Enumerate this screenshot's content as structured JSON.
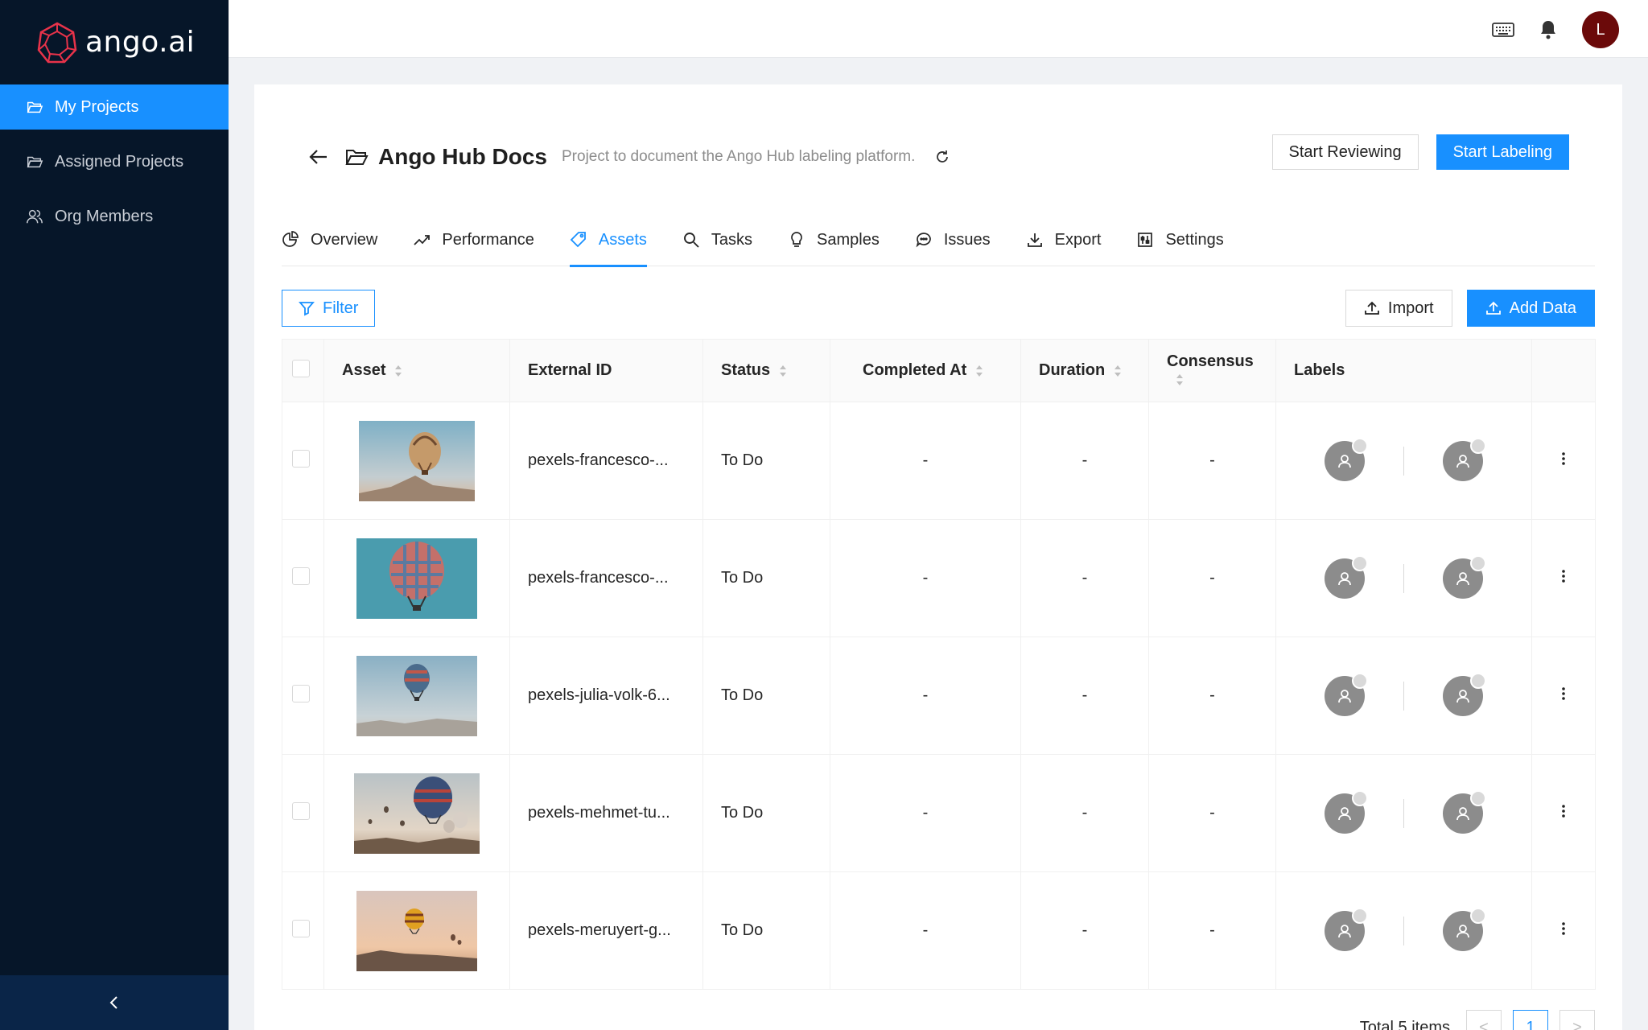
{
  "app": {
    "logo_text": "ango.ai"
  },
  "sidebar": {
    "items": [
      {
        "label": "My Projects",
        "icon": "folder-open-icon",
        "active": true
      },
      {
        "label": "Assigned Projects",
        "icon": "folder-open-icon",
        "active": false
      },
      {
        "label": "Org Members",
        "icon": "users-icon",
        "active": false
      }
    ]
  },
  "header": {
    "avatar_letter": "L"
  },
  "project": {
    "title": "Ango Hub Docs",
    "description": "Project to document the Ango Hub labeling platform.",
    "start_reviewing": "Start Reviewing",
    "start_labeling": "Start Labeling"
  },
  "tabs": [
    {
      "label": "Overview",
      "icon": "pie-chart-icon"
    },
    {
      "label": "Performance",
      "icon": "line-chart-icon"
    },
    {
      "label": "Assets",
      "icon": "tag-icon",
      "active": true
    },
    {
      "label": "Tasks",
      "icon": "search-icon"
    },
    {
      "label": "Samples",
      "icon": "bulb-icon"
    },
    {
      "label": "Issues",
      "icon": "comment-icon"
    },
    {
      "label": "Export",
      "icon": "download-icon"
    },
    {
      "label": "Settings",
      "icon": "settings-icon"
    }
  ],
  "toolbar": {
    "filter_label": "Filter",
    "import_label": "Import",
    "add_data_label": "Add Data"
  },
  "table": {
    "columns": [
      "Asset",
      "External ID",
      "Status",
      "Completed At",
      "Duration",
      "Consensus",
      "Labels"
    ],
    "rows": [
      {
        "external_id": "pexels-francesco-...",
        "status": "To Do",
        "completed_at": "-",
        "duration": "-",
        "consensus": "-"
      },
      {
        "external_id": "pexels-francesco-...",
        "status": "To Do",
        "completed_at": "-",
        "duration": "-",
        "consensus": "-"
      },
      {
        "external_id": "pexels-julia-volk-6...",
        "status": "To Do",
        "completed_at": "-",
        "duration": "-",
        "consensus": "-"
      },
      {
        "external_id": "pexels-mehmet-tu...",
        "status": "To Do",
        "completed_at": "-",
        "duration": "-",
        "consensus": "-"
      },
      {
        "external_id": "pexels-meruyert-g...",
        "status": "To Do",
        "completed_at": "-",
        "duration": "-",
        "consensus": "-"
      }
    ]
  },
  "pagination": {
    "total_text": "Total 5 items",
    "current_page": "1",
    "prev": "<",
    "next": ">"
  },
  "colors": {
    "accent": "#1890ff",
    "sidebar_bg": "#061629",
    "avatar_bg": "#6b0a0a",
    "consensus_dash": "#52c41a"
  }
}
